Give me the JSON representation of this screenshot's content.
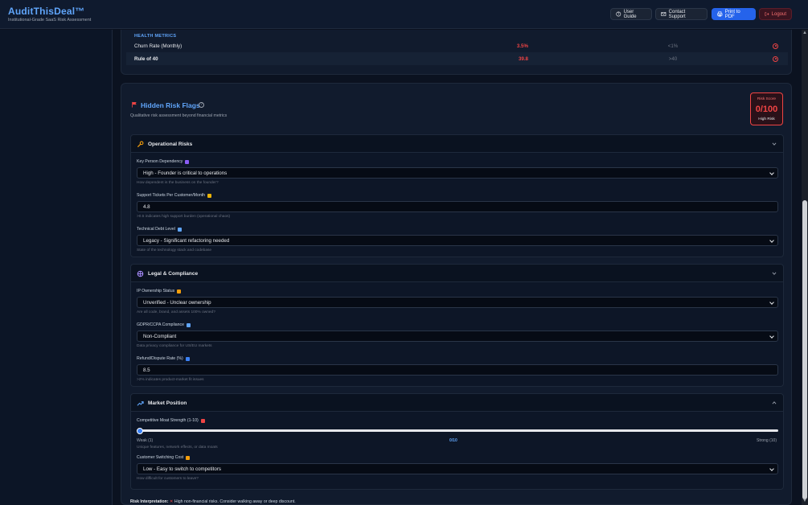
{
  "header": {
    "title": "AuditThisDeal™",
    "subtitle": "Institutional-Grade SaaS Risk Assessment",
    "buttons": {
      "user_guide": "User Guide",
      "contact_support": "Contact Support",
      "print_pdf": "Print to PDF",
      "logout": "Logout"
    }
  },
  "health_metrics": {
    "title": "HEALTH METRICS",
    "rows": [
      {
        "name": "Churn Rate (Monthly)",
        "value": "3.5%",
        "benchmark": "<1%"
      },
      {
        "name": "Rule of 40",
        "value": "39.8",
        "benchmark": ">40"
      }
    ]
  },
  "risk_flags": {
    "title": "Hidden Risk Flags",
    "subtitle": "Qualitative risk assessment beyond financial metrics",
    "score": {
      "label": "Risk Score",
      "value": "0/100",
      "level": "High Risk"
    },
    "operational": {
      "title": "Operational Risks",
      "key_person": {
        "label": "Key Person Dependency",
        "value": "High - Founder is critical to operations",
        "help": "How dependent is the business on the founder?"
      },
      "support_tickets": {
        "label": "Support Tickets Per Customer/Month",
        "value": "4.8",
        "help": ">0.5 indicates high support burden (operational chaos)"
      },
      "tech_debt": {
        "label": "Technical Debt Level",
        "value": "Legacy - Significant refactoring needed",
        "help": "State of the technology stack and codebase"
      }
    },
    "legal": {
      "title": "Legal & Compliance",
      "ip_ownership": {
        "label": "IP Ownership Status",
        "value": "Unverified - Unclear ownership",
        "help": "Are all code, brand, and assets 100% owned?"
      },
      "gdpr": {
        "label": "GDPR/CCPA Compliance",
        "value": "Non-Compliant",
        "help": "Data privacy compliance for US/EU markets"
      },
      "refund": {
        "label": "Refund/Dispute Rate (%)",
        "value": "8.5",
        "help": ">2% indicates product-market fit issues"
      }
    },
    "market": {
      "title": "Market Position",
      "moat": {
        "label": "Competitive Moat Strength (1-10)",
        "min_label": "Weak (1)",
        "value_label": "0/10",
        "max_label": "Strong (10)",
        "help": "Unique features, network effects, or data moats",
        "level": 0
      },
      "switching": {
        "label": "Customer Switching Cost",
        "value": "Low - Easy to switch to competitors",
        "help": "How difficult for customers to leave?"
      }
    },
    "interpretation": {
      "label": "Risk Interpretation:",
      "text": "High non-financial risks. Consider walking away or deep discount."
    }
  },
  "colors": {
    "accent": "#60a5fa",
    "danger": "#ef4444",
    "primary_button": "#2563eb"
  }
}
